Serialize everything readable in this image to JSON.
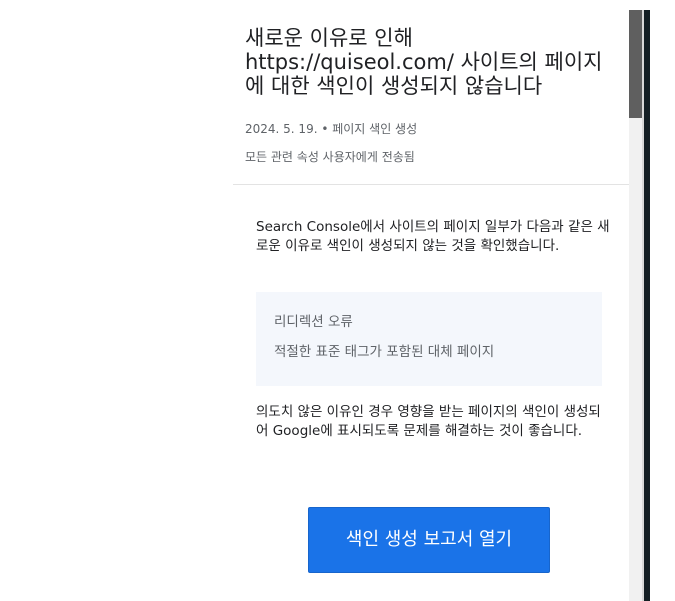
{
  "email": {
    "subject": "새로운 이유로 인해 https://quiseol.com/ 사이트의 페이지에 대한 색인이 생성되지 않습니다",
    "date_line": "2024. 5. 19. • 페이지 색인 생성",
    "recipients": "모든 관련 속성 사용자에게 전송됨",
    "intro": "Search Console에서 사이트의 페이지 일부가 다음과 같은 새로운 이유로 색인이 생성되지 않는 것을 확인했습니다.",
    "reasons": [
      "리디렉션 오류",
      "적절한 표준 태그가 포함된 대체 페이지"
    ],
    "outro": "의도치 않은 이유인 경우 영향을 받는 페이지의 색인이 생성되어 Google에 표시되도록 문제를 해결하는 것이 좋습니다.",
    "cta_label": "색인 생성 보고서 열기"
  },
  "colors": {
    "cta_background": "#1a73e8",
    "reason_box_background": "#f4f7fc",
    "scrollbar_thumb": "#5f5f5f"
  }
}
